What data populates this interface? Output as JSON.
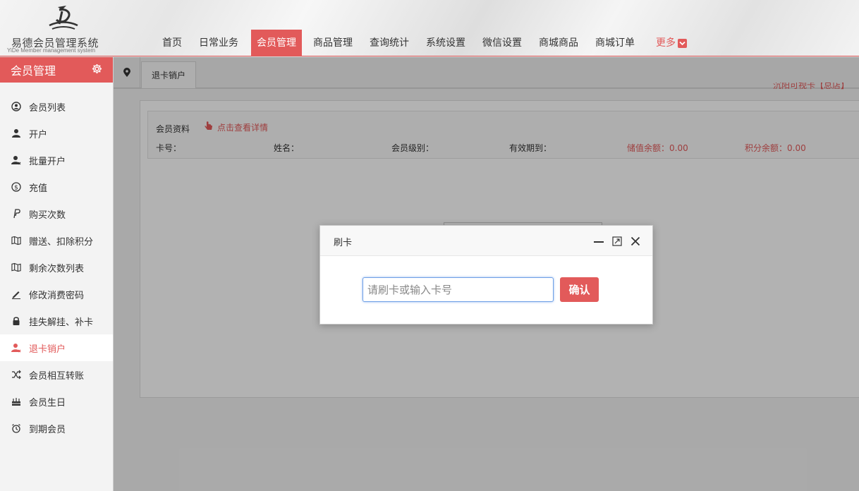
{
  "header": {
    "logo_title": "易德会员管理系统",
    "logo_subtitle": "YiDe Member management system",
    "nav": [
      {
        "label": "首页"
      },
      {
        "label": "日常业务"
      },
      {
        "label": "会员管理",
        "active": true
      },
      {
        "label": "商品管理"
      },
      {
        "label": "查询统计"
      },
      {
        "label": "系统设置"
      },
      {
        "label": "微信设置"
      },
      {
        "label": "商城商品"
      },
      {
        "label": "商城订单"
      }
    ],
    "more_label": "更多"
  },
  "sidebar": {
    "title": "会员管理",
    "items": [
      {
        "label": "会员列表",
        "icon": "user-circle-icon"
      },
      {
        "label": "开户",
        "icon": "user-icon"
      },
      {
        "label": "批量开户",
        "icon": "user-multiple-icon"
      },
      {
        "label": "充值",
        "icon": "coin-icon"
      },
      {
        "label": "购买次数",
        "icon": "paypal-icon"
      },
      {
        "label": "赠送、扣除积分",
        "icon": "map-icon"
      },
      {
        "label": "剩余次数列表",
        "icon": "map-icon"
      },
      {
        "label": "修改消费密码",
        "icon": "pencil-icon"
      },
      {
        "label": "挂失解挂、补卡",
        "icon": "lock-icon"
      },
      {
        "label": "退卡销户",
        "icon": "user-remove-icon",
        "active": true
      },
      {
        "label": "会员相互转账",
        "icon": "shuffle-icon"
      },
      {
        "label": "会员生日",
        "icon": "cake-icon"
      },
      {
        "label": "到期会员",
        "icon": "alarm-clock-icon"
      }
    ]
  },
  "tabs": {
    "active_tab": "退卡销户"
  },
  "top_link": "沉阳可视卡【总店】",
  "member_info": {
    "title": "会员资料",
    "detail_link": "点击查看详情",
    "card_no_label": "卡号：",
    "name_label": "姓名：",
    "level_label": "会员级别：",
    "expiry_label": "有效期到：",
    "balance_label": "储值余额：0.00",
    "points_label": "积分余额：0.00"
  },
  "dialog": {
    "title": "刷卡",
    "input_placeholder": "请刷卡或输入卡号",
    "confirm_label": "确认"
  },
  "colors": {
    "accent": "#e25a5a",
    "focus": "#6fa0e6"
  }
}
